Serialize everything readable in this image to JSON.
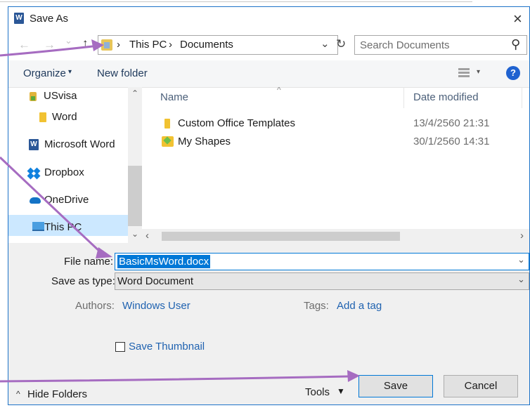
{
  "window": {
    "title": "Save As",
    "close_glyph": "×"
  },
  "nav": {
    "back_glyph": "←",
    "forward_glyph": "→",
    "recent_glyph": "⌄",
    "up_glyph": "↑",
    "breadcrumb": [
      "This PC",
      "Documents"
    ],
    "separator": "›",
    "dropdown_glyph": "⌄",
    "refresh_glyph": "↻",
    "search_placeholder": "Search Documents",
    "search_glyph": "⚲"
  },
  "toolbar": {
    "organize": "Organize",
    "organize_caret": "▾",
    "new_folder": "New folder",
    "view_caret": "▾",
    "help_glyph": "?"
  },
  "sidebar": {
    "items": [
      {
        "label": "USvisa",
        "icon": "folder-icon"
      },
      {
        "label": "Word",
        "icon": "folder-icon"
      },
      {
        "label": "Microsoft Word",
        "icon": "word-icon"
      },
      {
        "label": "Dropbox",
        "icon": "dropbox-icon"
      },
      {
        "label": "OneDrive",
        "icon": "onedrive-icon"
      },
      {
        "label": "This PC",
        "icon": "computer-icon"
      }
    ],
    "scroll_up": "⌃",
    "scroll_down": "⌄"
  },
  "file_list": {
    "columns": [
      "Name",
      "Date modified"
    ],
    "sort_glyph": "^",
    "rows": [
      {
        "name": "Custom Office Templates",
        "date": "13/4/2560 21:31",
        "icon": "folder-icon"
      },
      {
        "name": "My Shapes",
        "date": "30/1/2560 14:31",
        "icon": "shapes-folder-icon"
      }
    ],
    "scroll_left": "‹",
    "scroll_right": "›"
  },
  "form": {
    "file_name_label": "File name:",
    "file_name_value": "BasicMsWord.docx",
    "save_type_label": "Save as type:",
    "save_type_value": "Word Document",
    "authors_label": "Authors:",
    "authors_value": "Windows User",
    "tags_label": "Tags:",
    "tags_value": "Add a tag",
    "thumbnail_label": "Save Thumbnail",
    "dropdown_glyph": "⌄"
  },
  "footer": {
    "hide_folders": "Hide Folders",
    "hide_glyph": "^",
    "tools": "Tools",
    "tools_caret": "▼",
    "save": "Save",
    "cancel": "Cancel"
  },
  "colors": {
    "accent": "#1f62b0",
    "window_border": "#1e73c8",
    "annotation_arrow": "#a66cc1",
    "selection": "#0078d7"
  }
}
